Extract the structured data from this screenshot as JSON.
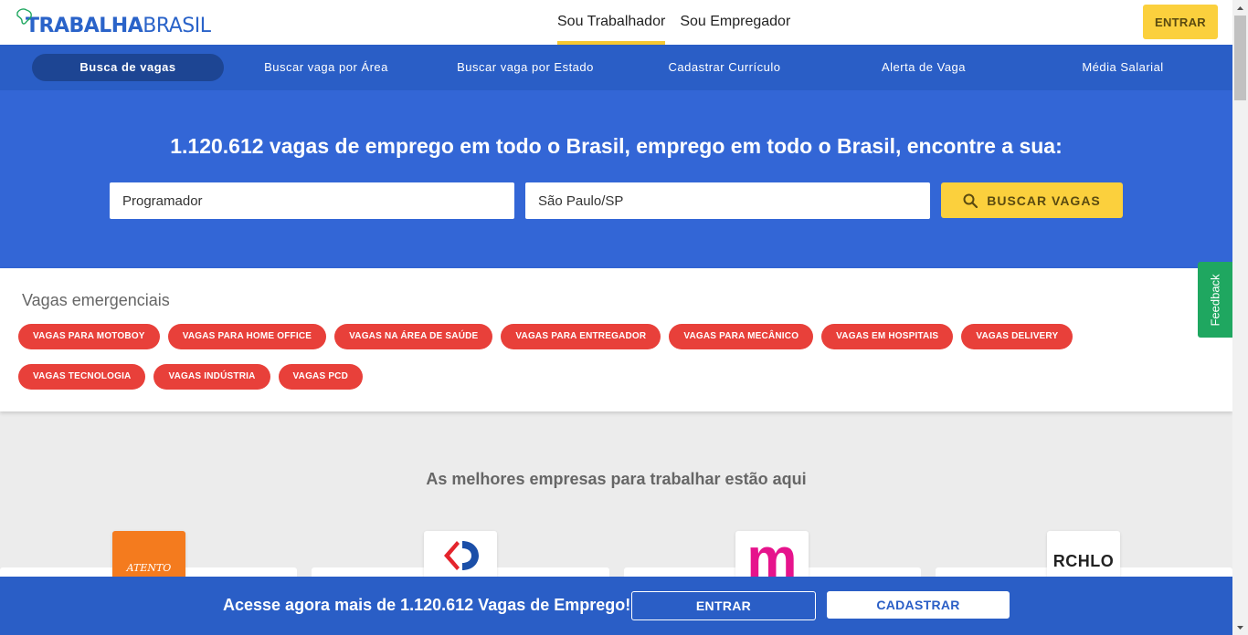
{
  "header": {
    "logo_part1": "TRABALHA",
    "logo_part2": "BRASIL",
    "tabs": [
      {
        "label": "Sou Trabalhador",
        "active": true
      },
      {
        "label": "Sou Empregador",
        "active": false
      }
    ],
    "login_label": "ENTRAR"
  },
  "nav": {
    "items": [
      {
        "label": "Busca de vagas",
        "active": true
      },
      {
        "label": "Buscar vaga por Área"
      },
      {
        "label": "Buscar vaga por Estado"
      },
      {
        "label": "Cadastrar Currículo"
      },
      {
        "label": "Alerta de Vaga"
      },
      {
        "label": "Média Salarial"
      }
    ]
  },
  "hero": {
    "title": "1.120.612 vagas de emprego em todo o Brasil, emprego em todo o Brasil, encontre a sua:",
    "job_value": "Programador",
    "location_value": "São Paulo/SP",
    "search_label": "BUSCAR VAGAS",
    "search_icon": "search-icon"
  },
  "emergency": {
    "title": "Vagas emergenciais",
    "chips": [
      "VAGAS PARA MOTOBOY",
      "VAGAS PARA HOME OFFICE",
      "VAGAS NA ÁREA DE SAÚDE",
      "VAGAS PARA ENTREGADOR",
      "VAGAS PARA MECÂNICO",
      "VAGAS EM HOSPITAIS",
      "VAGAS DELIVERY",
      "VAGAS TECNOLOGIA",
      "VAGAS INDÚSTRIA",
      "VAGAS PCD"
    ]
  },
  "companies": {
    "title": "As melhores empresas para trabalhar estão aqui",
    "logos": {
      "atento": "ATENTO",
      "m": "m",
      "rchlo": "RCHLO"
    }
  },
  "feedback_label": "Feedback",
  "bottom_bar": {
    "text": "Acesse agora mais de 1.120.612 Vagas de Emprego!",
    "login_label": "ENTRAR",
    "signup_label": "CADASTRAR"
  },
  "colors": {
    "brand_blue": "#2a5ec6",
    "hero_blue": "#3366d6",
    "accent_yellow": "#fbd03d",
    "chip_red": "#e8403a",
    "feedback_green": "#1fa760"
  }
}
